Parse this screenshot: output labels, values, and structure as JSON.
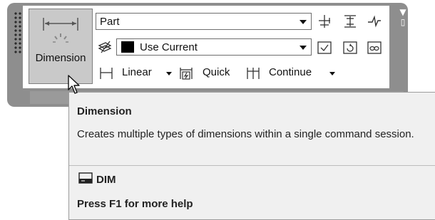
{
  "ribbon": {
    "big_button": {
      "label": "Dimension",
      "icon": "dimension-icon"
    },
    "style_dropdown": {
      "value": "Part"
    },
    "layer_dropdown": {
      "value": "Use Current",
      "swatch_color": "#000000"
    },
    "tools_row3": [
      {
        "label": "Linear",
        "icon": "linear-dimension-icon",
        "has_dropdown": true
      },
      {
        "label": "Quick",
        "icon": "quick-dimension-icon",
        "has_dropdown": false
      },
      {
        "label": "Continue",
        "icon": "continue-dimension-icon",
        "has_dropdown": true
      }
    ],
    "tools_right": [
      "dimension-space-icon",
      "dimension-break-icon",
      "jogged-linear-icon",
      "inspect-icon",
      "update-icon",
      "reassociate-icon"
    ]
  },
  "tooltip": {
    "title": "Dimension",
    "description": "Creates multiple types of dimensions within a single command session.",
    "command": "DIM",
    "help": "Press F1 for more help"
  }
}
